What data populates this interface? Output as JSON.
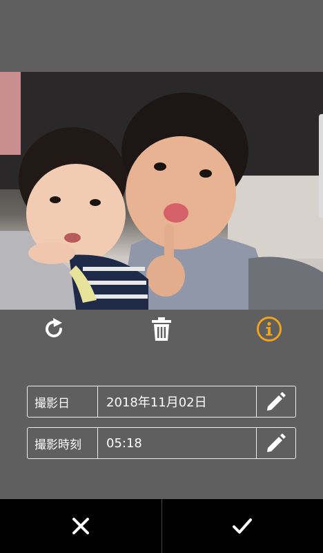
{
  "photo": {
    "description_icon": "photo-preview"
  },
  "toolbar": {
    "rotate_icon": "rotate-icon",
    "delete_icon": "trash-icon",
    "info_icon": "info-icon",
    "info_color": "#f0a41b"
  },
  "details": {
    "date_label": "撮影日",
    "date_value": "2018年11月02日",
    "time_label": "撮影時刻",
    "time_value": "05:18"
  },
  "bottom": {
    "cancel_icon": "close-icon",
    "confirm_icon": "check-icon"
  }
}
